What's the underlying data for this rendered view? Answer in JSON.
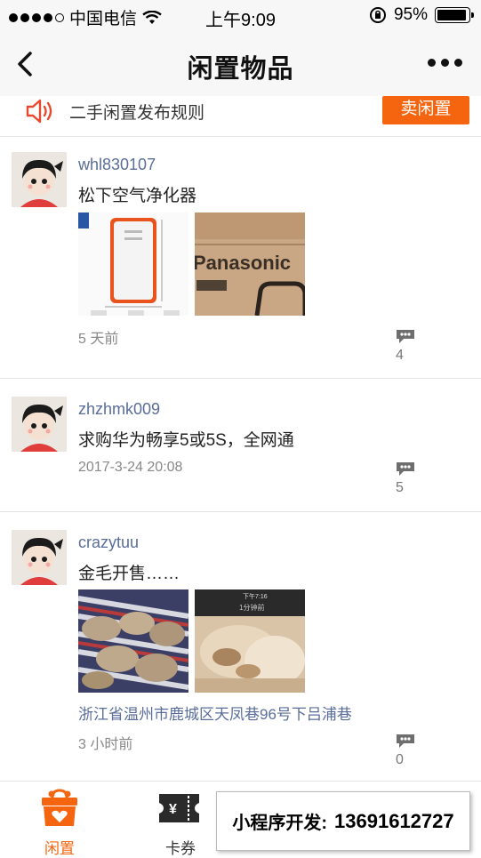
{
  "status_bar": {
    "carrier": "中国电信",
    "time": "上午9:09",
    "battery": "95%",
    "battery_level": 0.95
  },
  "nav": {
    "title": "闲置物品"
  },
  "notice": {
    "text": "二手闲置发布规则",
    "sell_label": "卖闲置"
  },
  "posts": [
    {
      "username": "whl830107",
      "content": "松下空气净化器",
      "time": "5 天前",
      "comments": "4",
      "photo_labels": [
        "Panasonic"
      ]
    },
    {
      "username": "zhzhmk009",
      "content": "求购华为畅享5或5S，全网通",
      "time": "2017-3-24 20:08",
      "comments": "5"
    },
    {
      "username": "crazytuu",
      "content": "金毛开售……",
      "location": "浙江省温州市鹿城区天凤巷96号下吕浦巷",
      "time": "3 小时前",
      "comments": "0",
      "photo_labels": [
        "下午7:16",
        "1分钟前"
      ]
    }
  ],
  "tabs": [
    {
      "label": "闲置",
      "icon": "gift-bag-icon",
      "active": true
    },
    {
      "label": "卡券",
      "icon": "ticket-icon",
      "active": false
    }
  ],
  "ad": {
    "label": "小程序开发:",
    "phone": "13691612727"
  },
  "colors": {
    "accent": "#f5650f",
    "link": "#5a6e99"
  }
}
